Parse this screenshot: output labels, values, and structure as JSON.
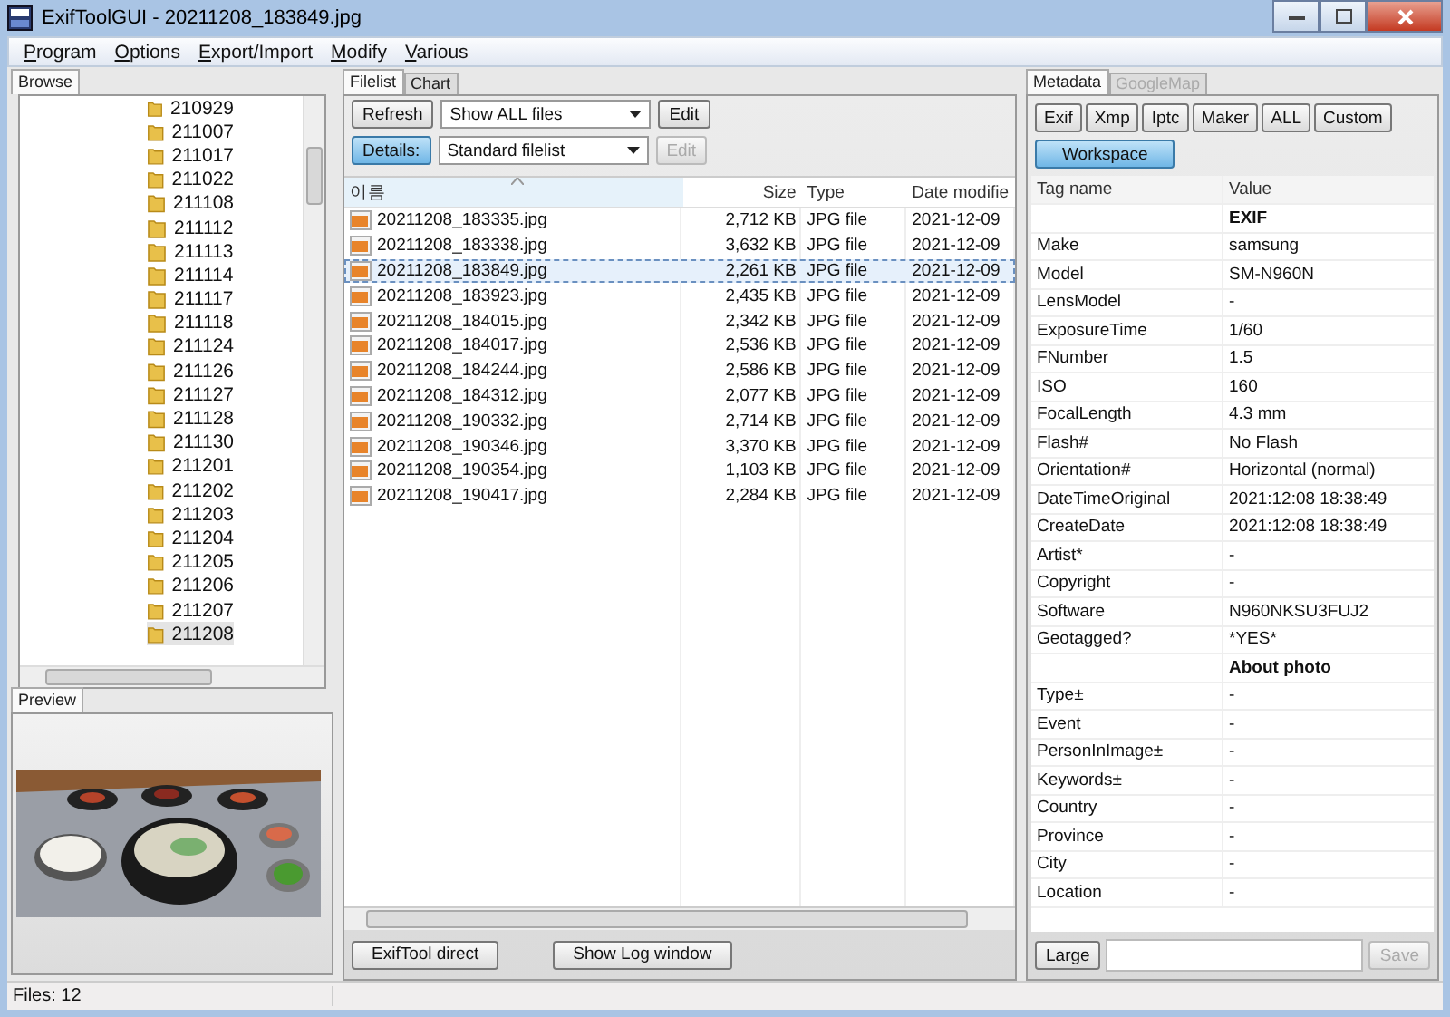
{
  "window": {
    "title": "ExifToolGUI - 20211208_183849.jpg"
  },
  "menu": [
    "Program",
    "Options",
    "Export/Import",
    "Modify",
    "Various"
  ],
  "browse": {
    "tab": {
      "label": "Browse",
      "selected": true
    },
    "folders": [
      {
        "name": "210929",
        "selected": false
      },
      {
        "name": "211007",
        "selected": false
      },
      {
        "name": "211017",
        "selected": false
      },
      {
        "name": "211022",
        "selected": false
      },
      {
        "name": "211108",
        "selected": false
      },
      {
        "name": "211112",
        "selected": false
      },
      {
        "name": "211113",
        "selected": false
      },
      {
        "name": "211114",
        "selected": false
      },
      {
        "name": "211117",
        "selected": false
      },
      {
        "name": "211118",
        "selected": false
      },
      {
        "name": "211124",
        "selected": false
      },
      {
        "name": "211126",
        "selected": false
      },
      {
        "name": "211127",
        "selected": false
      },
      {
        "name": "211128",
        "selected": false
      },
      {
        "name": "211130",
        "selected": false
      },
      {
        "name": "211201",
        "selected": false
      },
      {
        "name": "211202",
        "selected": false
      },
      {
        "name": "211203",
        "selected": false
      },
      {
        "name": "211204",
        "selected": false
      },
      {
        "name": "211205",
        "selected": false
      },
      {
        "name": "211206",
        "selected": false
      },
      {
        "name": "211207",
        "selected": false
      },
      {
        "name": "211208",
        "selected": true
      }
    ]
  },
  "preview": {
    "tab": {
      "label": "Preview",
      "selected": true
    }
  },
  "filelist": {
    "tabs": [
      {
        "label": "Filelist",
        "selected": true
      },
      {
        "label": "Chart",
        "selected": false
      }
    ],
    "refresh": "Refresh",
    "filter": "Show ALL files",
    "edit_filter": {
      "label": "Edit",
      "disabled": false
    },
    "details": {
      "label": "Details:",
      "pressed": true
    },
    "view": "Standard filelist",
    "edit_view": {
      "label": "Edit",
      "disabled": true
    },
    "columns": [
      "이름",
      "Size",
      "Type",
      "Date modifie"
    ],
    "rows": [
      {
        "name": "20211208_183335.jpg",
        "size": "2,712 KB",
        "type": "JPG file",
        "date": "2021-12-09",
        "selected": false
      },
      {
        "name": "20211208_183338.jpg",
        "size": "3,632 KB",
        "type": "JPG file",
        "date": "2021-12-09",
        "selected": false
      },
      {
        "name": "20211208_183849.jpg",
        "size": "2,261 KB",
        "type": "JPG file",
        "date": "2021-12-09",
        "selected": true
      },
      {
        "name": "20211208_183923.jpg",
        "size": "2,435 KB",
        "type": "JPG file",
        "date": "2021-12-09",
        "selected": false
      },
      {
        "name": "20211208_184015.jpg",
        "size": "2,342 KB",
        "type": "JPG file",
        "date": "2021-12-09",
        "selected": false
      },
      {
        "name": "20211208_184017.jpg",
        "size": "2,536 KB",
        "type": "JPG file",
        "date": "2021-12-09",
        "selected": false
      },
      {
        "name": "20211208_184244.jpg",
        "size": "2,586 KB",
        "type": "JPG file",
        "date": "2021-12-09",
        "selected": false
      },
      {
        "name": "20211208_184312.jpg",
        "size": "2,077 KB",
        "type": "JPG file",
        "date": "2021-12-09",
        "selected": false
      },
      {
        "name": "20211208_190332.jpg",
        "size": "2,714 KB",
        "type": "JPG file",
        "date": "2021-12-09",
        "selected": false
      },
      {
        "name": "20211208_190346.jpg",
        "size": "3,370 KB",
        "type": "JPG file",
        "date": "2021-12-09",
        "selected": false
      },
      {
        "name": "20211208_190354.jpg",
        "size": "1,103 KB",
        "type": "JPG file",
        "date": "2021-12-09",
        "selected": false
      },
      {
        "name": "20211208_190417.jpg",
        "size": "2,284 KB",
        "type": "JPG file",
        "date": "2021-12-09",
        "selected": false
      }
    ],
    "buttons": [
      "ExifTool direct",
      "Show Log window"
    ]
  },
  "metadata": {
    "tabs": [
      {
        "label": "Metadata",
        "selected": true,
        "disabled": false
      },
      {
        "label": "GoogleMap",
        "selected": false,
        "disabled": true
      }
    ],
    "groups": [
      {
        "label": "Exif",
        "selected": false
      },
      {
        "label": "Xmp",
        "selected": false
      },
      {
        "label": "Iptc",
        "selected": false
      },
      {
        "label": "Maker",
        "selected": false
      },
      {
        "label": "ALL",
        "selected": false
      },
      {
        "label": "Custom",
        "selected": false
      },
      {
        "label": "Workspace",
        "selected": true
      }
    ],
    "columns": [
      "Tag name",
      "Value"
    ],
    "rows": [
      {
        "kind": "header",
        "value": "EXIF"
      },
      {
        "kind": "tag",
        "tag": "Make",
        "value": "samsung"
      },
      {
        "kind": "tag",
        "tag": "Model",
        "value": "SM-N960N"
      },
      {
        "kind": "tag",
        "tag": "LensModel",
        "value": "-"
      },
      {
        "kind": "tag",
        "tag": "ExposureTime",
        "value": "1/60"
      },
      {
        "kind": "tag",
        "tag": "FNumber",
        "value": "1.5"
      },
      {
        "kind": "tag",
        "tag": "ISO",
        "value": "160"
      },
      {
        "kind": "tag",
        "tag": "FocalLength",
        "value": "4.3 mm"
      },
      {
        "kind": "tag",
        "tag": "Flash#",
        "value": "No Flash"
      },
      {
        "kind": "tag",
        "tag": "Orientation#",
        "value": "Horizontal (normal)"
      },
      {
        "kind": "tag",
        "tag": "DateTimeOriginal",
        "value": "2021:12:08 18:38:49"
      },
      {
        "kind": "tag",
        "tag": "CreateDate",
        "value": "2021:12:08 18:38:49"
      },
      {
        "kind": "tag",
        "tag": "Artist*",
        "value": "-"
      },
      {
        "kind": "tag",
        "tag": "Copyright",
        "value": "-"
      },
      {
        "kind": "tag",
        "tag": "Software",
        "value": "N960NKSU3FUJ2"
      },
      {
        "kind": "tag",
        "tag": "Geotagged?",
        "value": "*YES*"
      },
      {
        "kind": "header",
        "value": "About photo"
      },
      {
        "kind": "tag",
        "tag": "Type±",
        "value": "-"
      },
      {
        "kind": "tag",
        "tag": "Event",
        "value": "-"
      },
      {
        "kind": "tag",
        "tag": "PersonInImage±",
        "value": "-"
      },
      {
        "kind": "tag",
        "tag": "Keywords±",
        "value": "-"
      },
      {
        "kind": "tag",
        "tag": "Country",
        "value": "-"
      },
      {
        "kind": "tag",
        "tag": "Province",
        "value": "-"
      },
      {
        "kind": "tag",
        "tag": "City",
        "value": "-"
      },
      {
        "kind": "tag",
        "tag": "Location",
        "value": "-"
      }
    ],
    "large": "Large",
    "save": {
      "label": "Save",
      "disabled": true
    }
  },
  "status_bar": "Files: 12"
}
